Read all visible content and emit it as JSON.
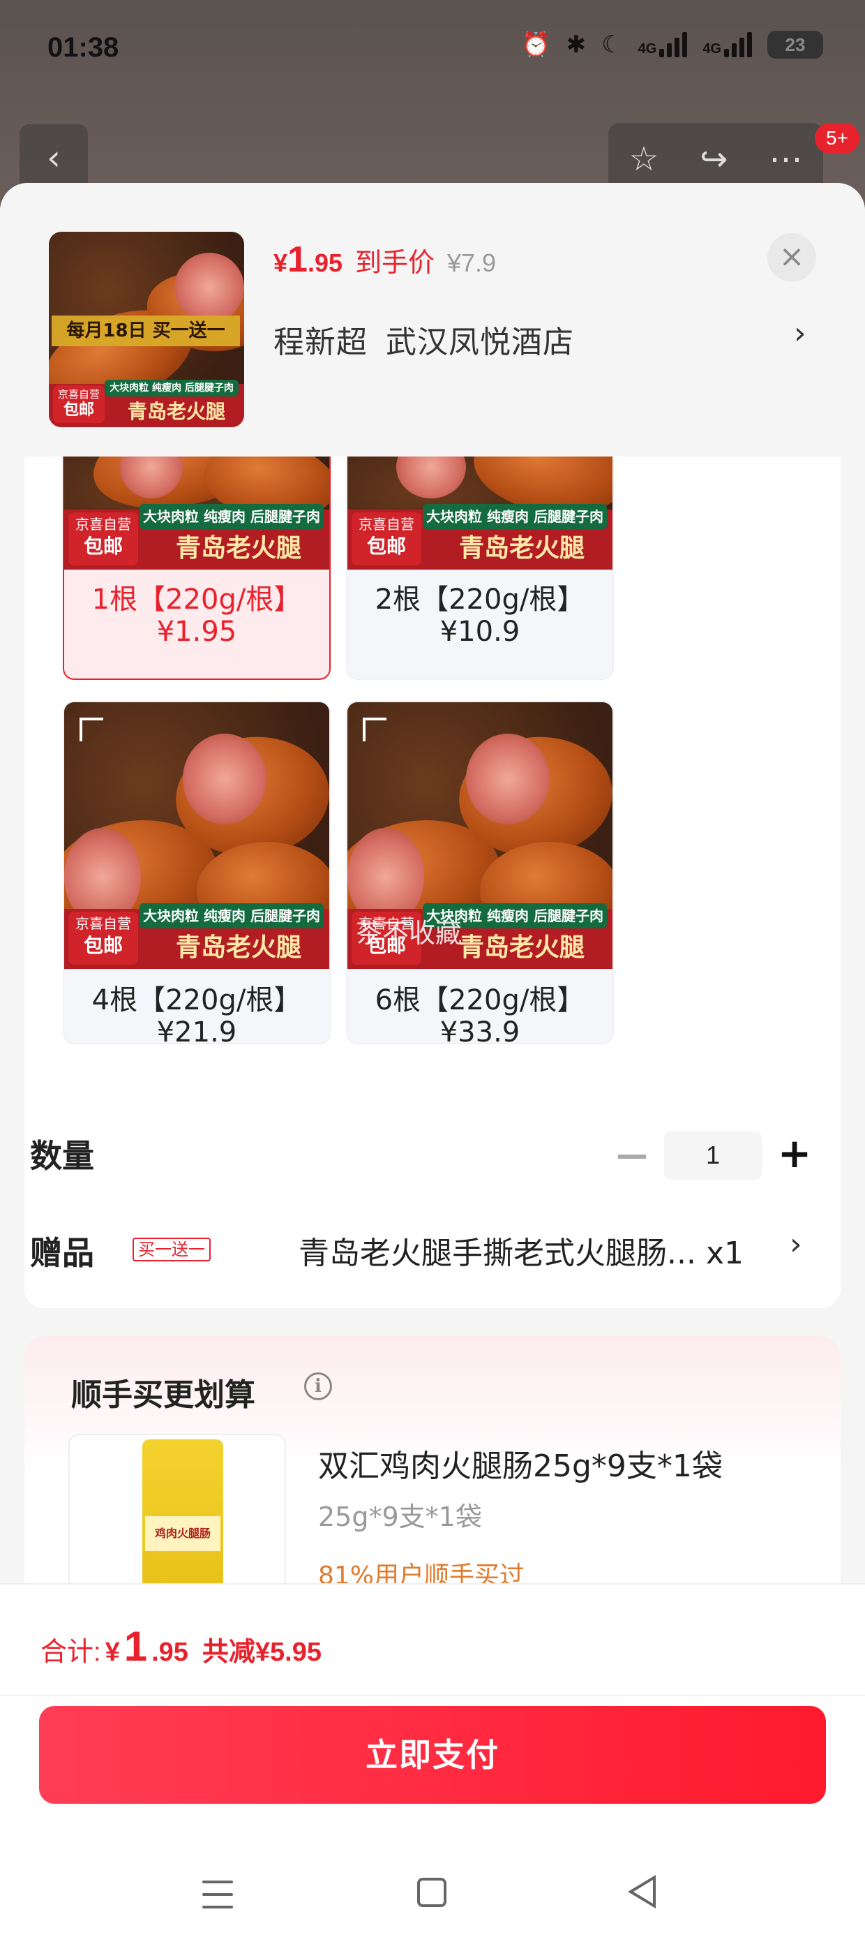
{
  "status_bar": {
    "time": "01:38",
    "network1": "4G",
    "network2": "4G",
    "battery": "23"
  },
  "background_nav": {
    "cart_badge": "5+"
  },
  "header": {
    "price_currency": "¥",
    "price_int": "1",
    "price_dec": ".95",
    "price_tag": "到手价",
    "original_price": "¥7.9",
    "address_name": "程新超",
    "address_place": "武汉凤悦酒店"
  },
  "product_image": {
    "promo_text": "每月18日 买一送一",
    "green_strip": "大块肉粒 纯瘦肉 后腿腱子肉",
    "title": "青岛老火腿",
    "badge_top": "京喜自营",
    "badge_bottom": "包邮"
  },
  "skus": [
    {
      "label": "1根【220g/根】",
      "price": "¥1.95",
      "selected": true
    },
    {
      "label": "2根【220g/根】",
      "price": "¥10.9",
      "selected": false
    },
    {
      "label": "4根【220g/根】",
      "price": "¥21.9",
      "selected": false
    },
    {
      "label": "6根【220g/根】",
      "price": "¥33.9",
      "selected": false
    }
  ],
  "quantity": {
    "label": "数量",
    "value": "1"
  },
  "gift": {
    "label": "赠品",
    "tag": "买一送一",
    "name": "青岛老火腿手撕老式火腿肠...",
    "count": "x1"
  },
  "watermark": "茶不收藏",
  "upsell": {
    "title": "顺手买更划算",
    "item_name": "双汇鸡肉火腿肠25g*9支*1袋",
    "item_spec": "25g*9支*1袋",
    "item_stat": "81%用户顺手买过",
    "pack_text": "鸡肉火腿肠"
  },
  "footer": {
    "total_label": "合计:",
    "total_currency": "¥",
    "total_int": "1",
    "total_dec": ".95",
    "discount": "共减¥5.95",
    "pay_label": "立即支付"
  },
  "colors": {
    "accent": "#e8222d",
    "pay_button": "#ff1a2e",
    "stat_orange": "#e07a2c"
  }
}
